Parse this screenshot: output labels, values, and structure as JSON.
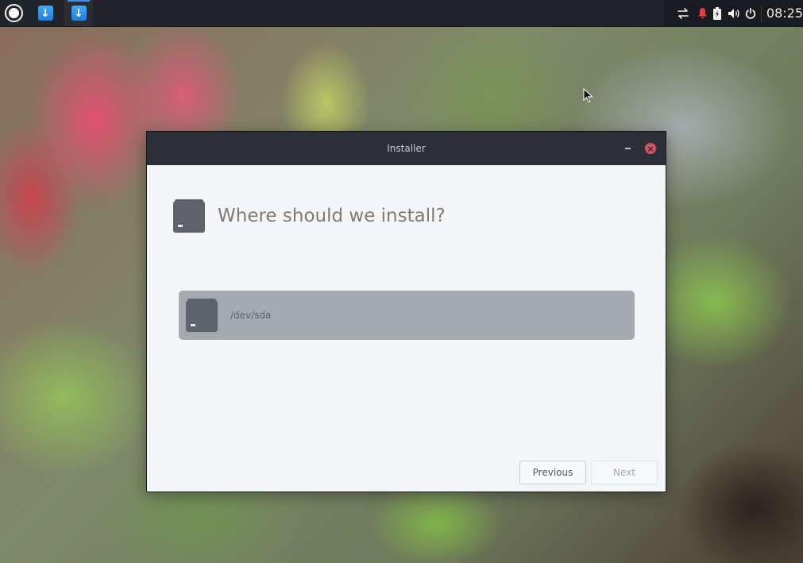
{
  "taskbar": {
    "launcher_icon": "launcher-circle-icon",
    "tasks": [
      {
        "name": "installer-task",
        "icon": "download-arrow-icon",
        "glyph": "↓",
        "active": false
      },
      {
        "name": "installer-task-active",
        "icon": "download-arrow-icon",
        "glyph": "↓",
        "active": true
      }
    ],
    "tray": {
      "icons": [
        "network-transfer-icon",
        "notification-bell-icon",
        "battery-charging-icon",
        "volume-icon",
        "power-icon"
      ],
      "notification_color": "#f2383e",
      "clock": "08:25"
    }
  },
  "window": {
    "title": "Installer",
    "minimize_glyph": "−",
    "close_glyph": "×",
    "close_color": "#d2545c",
    "heading": "Where should we install?",
    "disks": [
      {
        "label": "/dev/sda",
        "selected": true
      }
    ],
    "buttons": {
      "previous": "Previous",
      "next": "Next",
      "next_enabled": false
    }
  }
}
